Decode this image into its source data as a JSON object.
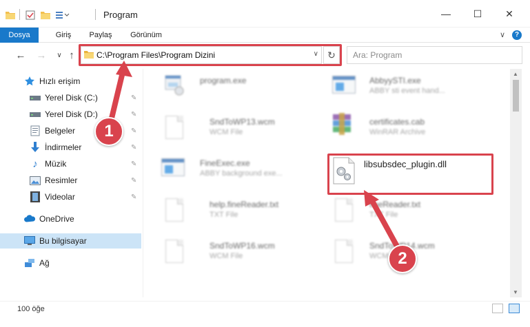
{
  "window": {
    "title": "Program",
    "minimize_glyph": "—",
    "maximize_glyph": "☐",
    "close_glyph": "✕"
  },
  "ribbon": {
    "tabs": [
      "Dosya",
      "Giriş",
      "Paylaş",
      "Görünüm"
    ],
    "active_tab": "Dosya",
    "help_glyph": "?",
    "collapse_glyph": "∨"
  },
  "nav": {
    "back_glyph": "←",
    "forward_glyph": "→",
    "recent_glyph": "∨",
    "up_glyph": "↑",
    "address": "C:\\Program Files\\Program Dizini",
    "address_dropdown_glyph": "∨",
    "refresh_glyph": "↻",
    "search_placeholder": "Ara: Program"
  },
  "sidebar": {
    "items": [
      {
        "label": "Hızlı erişim",
        "icon": "star-icon",
        "pinned": false
      },
      {
        "label": "Yerel Disk (C:)",
        "icon": "drive-icon",
        "pinned": true
      },
      {
        "label": "Yerel Disk (D:)",
        "icon": "drive-icon",
        "pinned": true
      },
      {
        "label": "Belgeler",
        "icon": "documents-icon",
        "pinned": true
      },
      {
        "label": "İndirmeler",
        "icon": "download-icon",
        "pinned": true
      },
      {
        "label": "Müzik",
        "icon": "music-icon",
        "pinned": true
      },
      {
        "label": "Resimler",
        "icon": "pictures-icon",
        "pinned": true
      },
      {
        "label": "Videolar",
        "icon": "video-icon",
        "pinned": true
      },
      {
        "label": "OneDrive",
        "icon": "cloud-icon",
        "pinned": false
      },
      {
        "label": "Bu bilgisayar",
        "icon": "computer-icon",
        "pinned": false
      },
      {
        "label": "Ağ",
        "icon": "network-icon",
        "pinned": false
      }
    ],
    "selected": "Bu bilgisayar",
    "pin_glyph": "📌"
  },
  "files": [
    {
      "name": "program.exe",
      "type": "",
      "icon": "exe-icon"
    },
    {
      "name": "AbbyySTI.exe",
      "type": "ABBY sti event hand...",
      "icon": "app-icon"
    },
    {
      "name": "SndToWP13.wcm",
      "type": "WCM File",
      "icon": "file-icon"
    },
    {
      "name": "certificates.cab",
      "type": "WinRAR Archive",
      "icon": "winrar-icon"
    },
    {
      "name": "FineExec.exe",
      "type": "ABBY background exe...",
      "icon": "app-icon"
    },
    {
      "name": "libsubsdec_plugin.dll",
      "type": "",
      "icon": "dll-icon"
    },
    {
      "name": "help.fineReader.txt",
      "type": "TXT File",
      "icon": "file-icon"
    },
    {
      "name": "fineReader.txt",
      "type": "TXT File",
      "icon": "file-icon"
    },
    {
      "name": "SndToWP16.wcm",
      "type": "WCM File",
      "icon": "file-icon"
    },
    {
      "name": "SndToWP14.wcm",
      "type": "WCM File",
      "icon": "file-icon"
    }
  ],
  "status": {
    "item_count": "100 öğe"
  },
  "callouts": [
    "1",
    "2"
  ],
  "colors": {
    "accent": "#1979ca",
    "highlight": "#d9434d",
    "selection": "#cce4f7"
  }
}
